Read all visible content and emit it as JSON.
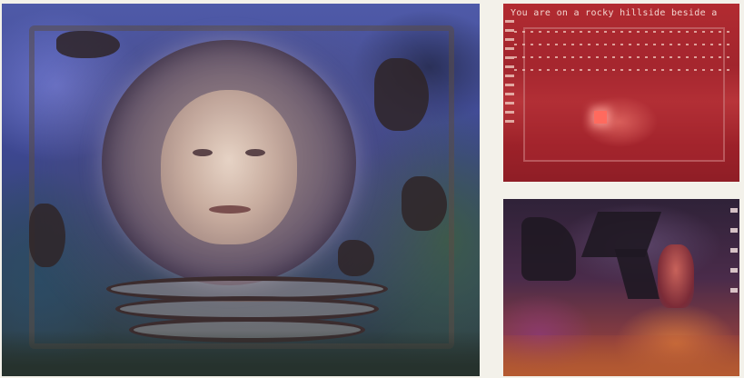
{
  "layout": {
    "panels": [
      {
        "id": "main",
        "kind": "screenshot",
        "subject": "crystal-ball-portrait"
      },
      {
        "id": "top-right",
        "kind": "screenshot",
        "subject": "text-adventure-screen"
      },
      {
        "id": "bottom-right",
        "kind": "screenshot",
        "subject": "dark-scene"
      }
    ]
  },
  "top_right": {
    "text_line": "You are on a rocky hillside beside a"
  },
  "colors": {
    "main_sky": "#4f5aa8",
    "top_right_bg": "#a4232a",
    "bottom_right_bg": "#3a2440",
    "page_bg": "#f3f1ea"
  }
}
